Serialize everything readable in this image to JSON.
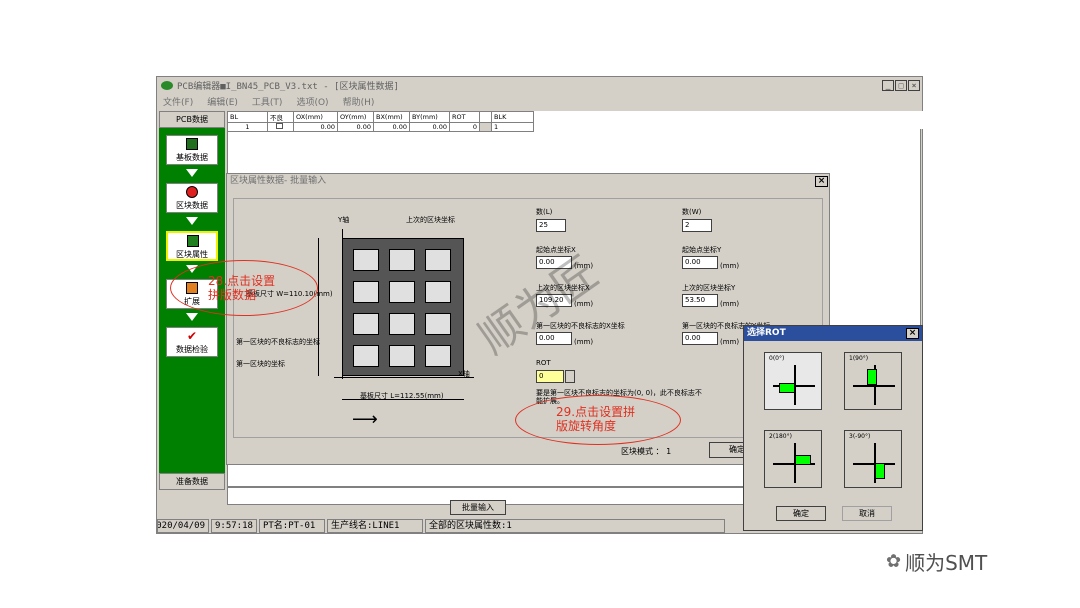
{
  "window": {
    "title": "PCB编辑器■I_BN45_PCB_V3.txt - [区块属性数据]",
    "controls": [
      "_",
      "□",
      "×"
    ]
  },
  "menu": [
    "文件(F)",
    "编辑(E)",
    "工具(T)",
    "选项(O)",
    "帮助(H)"
  ],
  "sidebar": {
    "top_tab": "PCB数据",
    "items": [
      {
        "label": "基板数据",
        "icon": "board-icon"
      },
      {
        "label": "区块数据",
        "icon": "block-icon"
      },
      {
        "label": "区块属性",
        "icon": "block-attr-icon"
      },
      {
        "label": "扩展",
        "icon": "expand-icon"
      },
      {
        "label": "数据检验",
        "icon": "check-icon"
      }
    ],
    "bottom_tab": "准备数据"
  },
  "grid": {
    "headers": [
      "BL",
      "不良",
      "OX(mm)",
      "OY(mm)",
      "BX(mm)",
      "BY(mm)",
      "ROT",
      "",
      "BLK"
    ],
    "row": [
      "1",
      "",
      "0.00",
      "0.00",
      "0.00",
      "0.00",
      "0",
      "",
      "1"
    ]
  },
  "dialog": {
    "title": "区块属性数据- 批量输入",
    "diagram": {
      "y_axis": "Y轴",
      "x_axis": "X轴",
      "last_block_coord": "上次的区块坐标",
      "board_width": "基板尺寸 W=110.10(mm)",
      "board_length": "基板尺寸 L=112.55(mm)",
      "first_bad_mark": "第一区块的不良标志的坐标",
      "first_block_coord": "第一区块的坐标"
    },
    "fields": {
      "count_l_label": "数(L)",
      "count_l": "25",
      "count_w_label": "数(W)",
      "count_w": "2",
      "start_x_label": "起始点坐标X",
      "start_x": "0.00",
      "start_y_label": "起始点坐标Y",
      "start_y": "0.00",
      "last_x_label": "上次的区块坐标X",
      "last_x": "109.20",
      "last_y_label": "上次的区块坐标Y",
      "last_y": "53.50",
      "bad_x_label": "第一区块的不良标志的X坐标",
      "bad_x": "0.00",
      "bad_y_label": "第一区块的不良标志的Y坐标",
      "bad_y": "0.00",
      "rot_label": "ROT",
      "rot": "0",
      "unit": "(mm)",
      "note": "要是第一区块不良标志的坐标为(0, 0)，此不良标志不能扩展。"
    },
    "block_mode": "区块模式 ： 1",
    "ok": "确定",
    "batch_input": "批量输入"
  },
  "rot_dialog": {
    "title": "选择ROT",
    "options": [
      "0(0°)",
      "1(90°)",
      "2(180°)",
      "3(-90°)"
    ],
    "ok": "确定",
    "cancel": "取消"
  },
  "status": [
    "2020/04/09",
    "9:57:18",
    "PT名:PT-01",
    "生产线名:LINE1",
    "全部的区块属性数:1"
  ],
  "annotations": {
    "a28": "28.点击设置\n拼版数据",
    "a29": "29.点击设置拼\n版旋转角度"
  },
  "watermark": "顺为匠",
  "brand": "顺为SMT",
  "colors": {
    "sidebar": "#008000",
    "annotation": "#e03020",
    "rot_title": "#2b4f9c"
  }
}
